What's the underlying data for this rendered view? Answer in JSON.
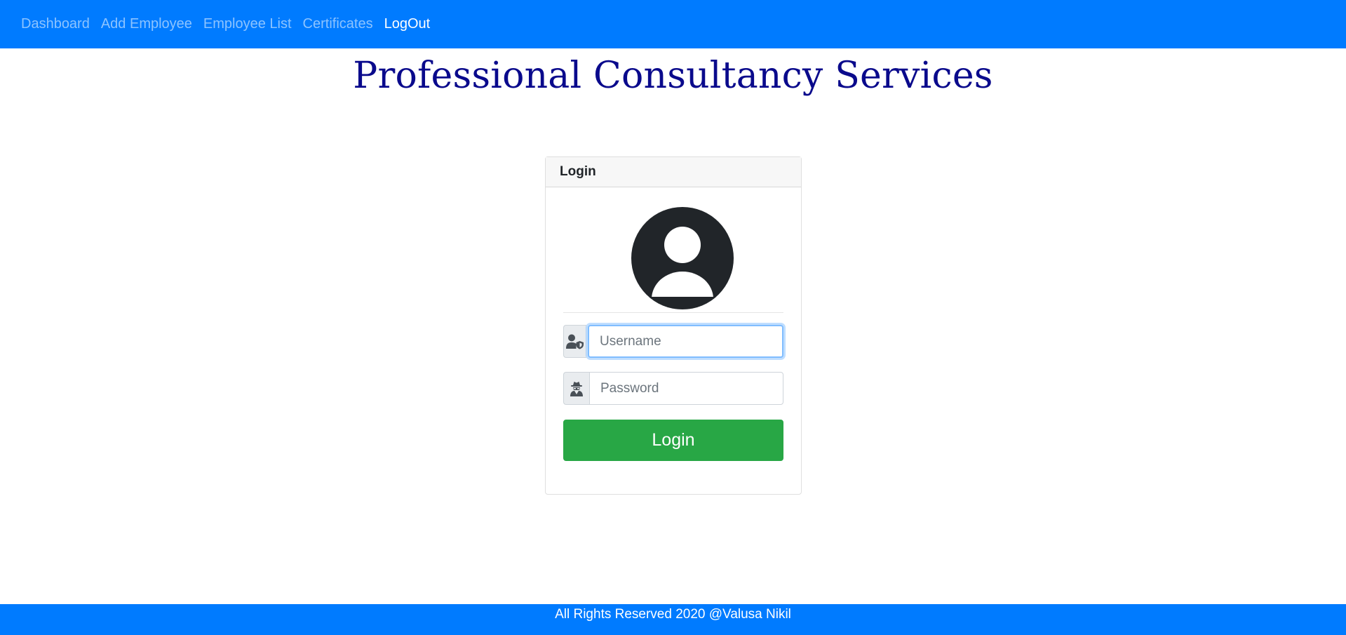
{
  "nav": {
    "items": [
      {
        "label": "Dashboard"
      },
      {
        "label": "Add Employee"
      },
      {
        "label": "Employee List"
      },
      {
        "label": "Certificates"
      },
      {
        "label": "LogOut"
      }
    ],
    "active_item": "LogOut",
    "background_color": "#007bff"
  },
  "header": {
    "title": "Professional Consultancy Services",
    "title_color": "#0a0a8c"
  },
  "login_card": {
    "header_label": "Login",
    "avatar_icon": "user-circle-icon",
    "username": {
      "placeholder": "Username",
      "value": "",
      "icon": "user-shield-icon",
      "focused": true
    },
    "password": {
      "placeholder": "Password",
      "value": "",
      "icon": "user-secret-icon"
    },
    "submit_label": "Login",
    "submit_color": "#28a745"
  },
  "footer": {
    "text": "All Rights Reserved 2020 @Valusa Nikil"
  }
}
